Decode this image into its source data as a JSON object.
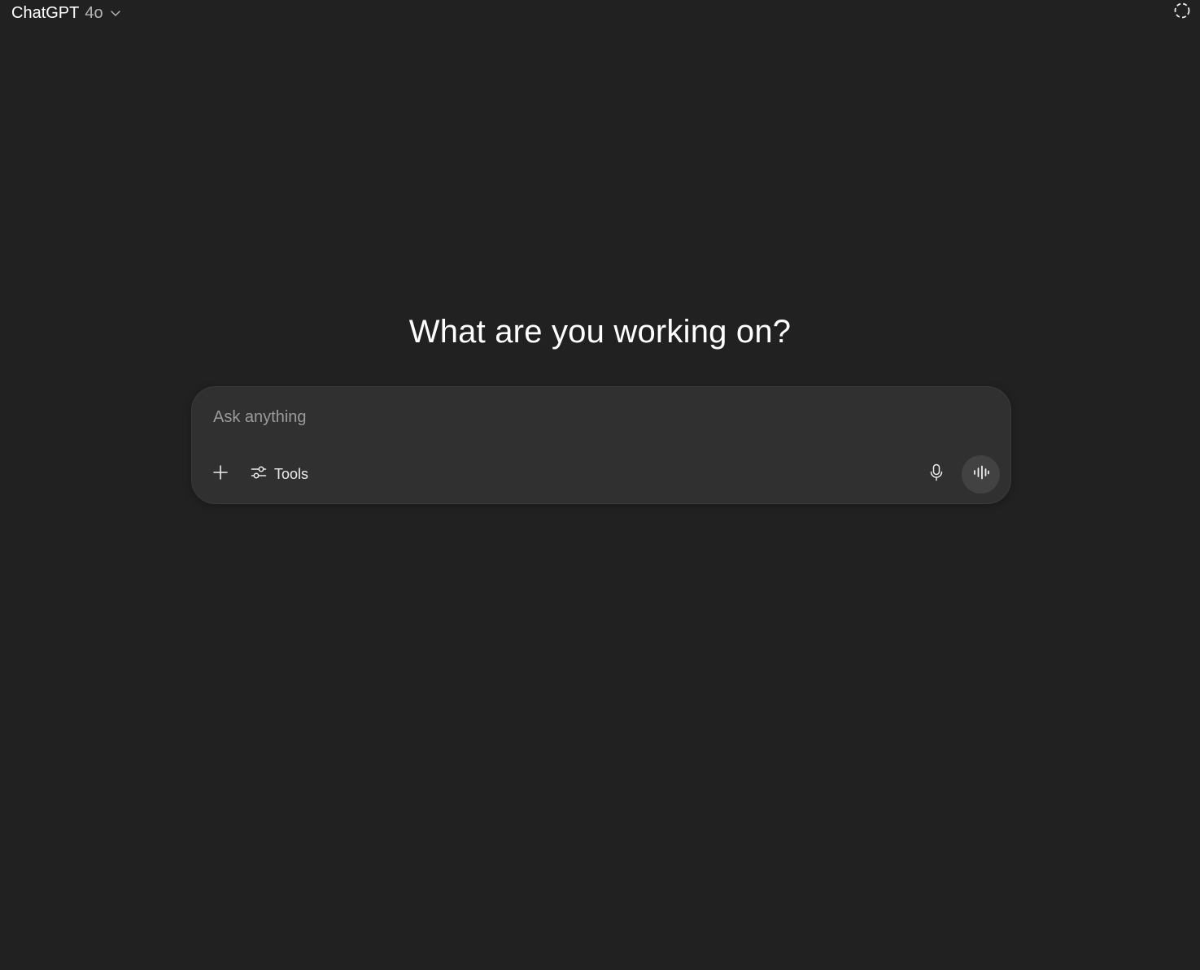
{
  "header": {
    "model_name": "ChatGPT",
    "model_version": "4o",
    "switcher_icon": "chevron-down-icon",
    "temp_chat_icon": "dashed-circle-icon"
  },
  "main": {
    "headline": "What are you working on?"
  },
  "composer": {
    "placeholder": "Ask anything",
    "value": "",
    "add_icon": "plus-icon",
    "tools_icon": "sliders-icon",
    "tools_label": "Tools",
    "mic_icon": "microphone-icon",
    "voice_icon": "voice-waveform-icon"
  },
  "colors": {
    "background": "#212121",
    "composer_bg": "#303030",
    "voice_button_bg": "#424242",
    "text": "#ececec",
    "placeholder": "#9b9b9b"
  }
}
